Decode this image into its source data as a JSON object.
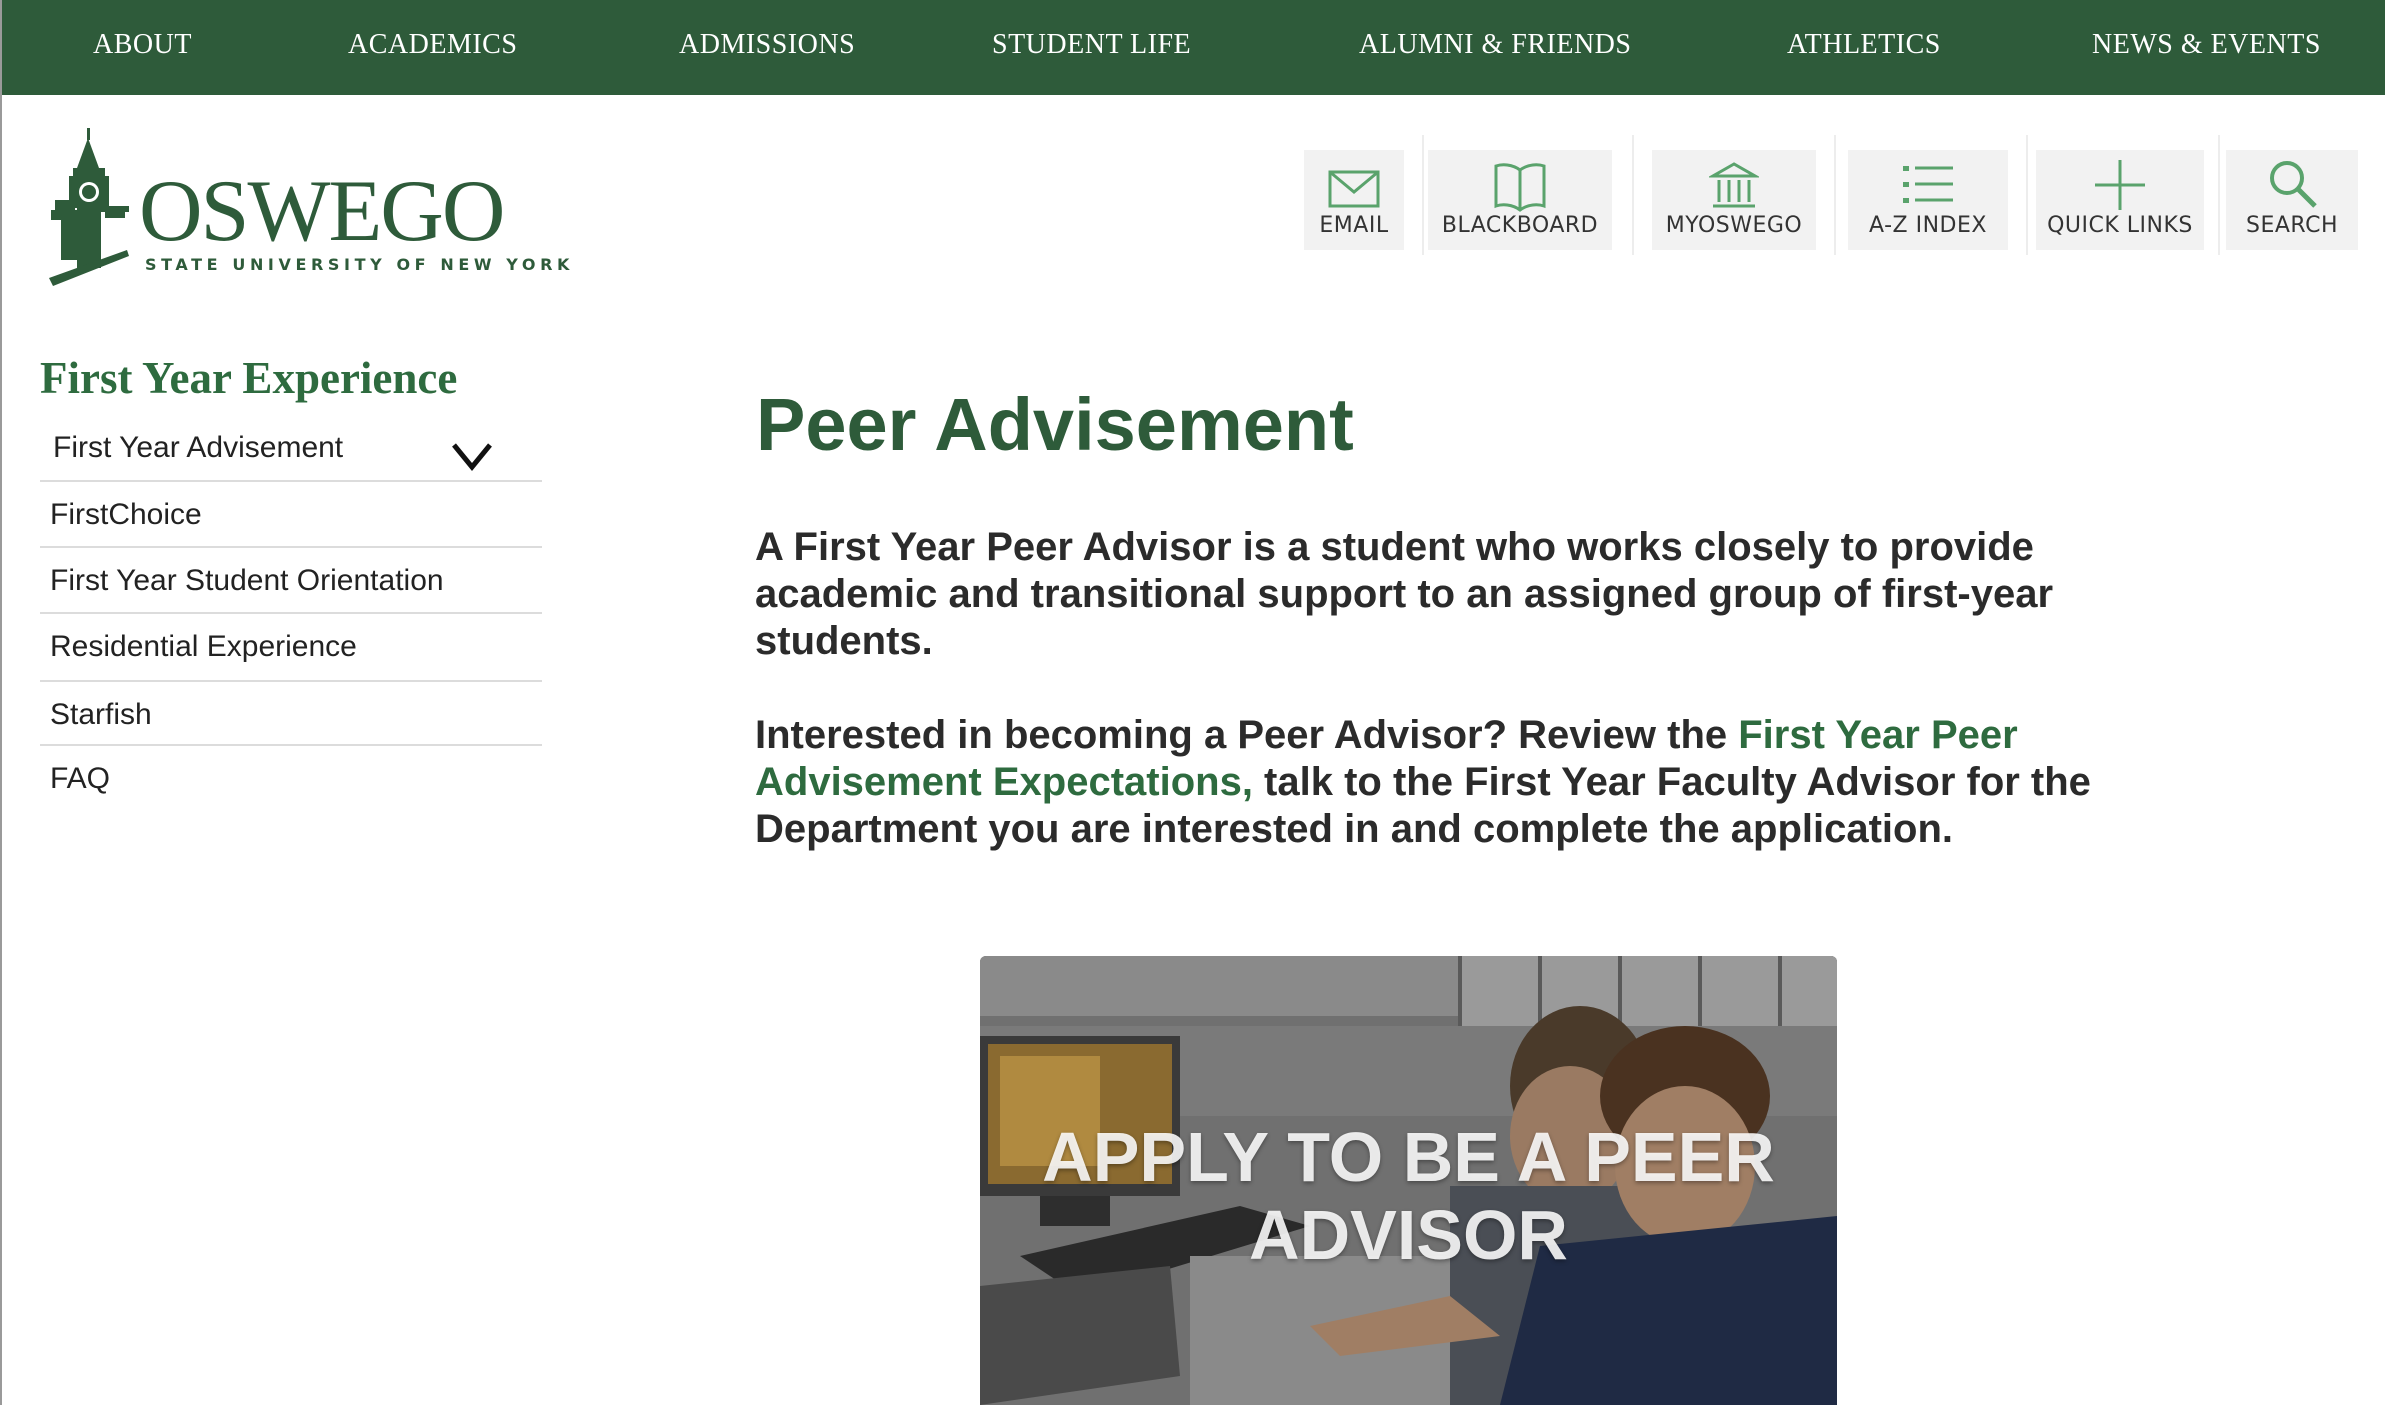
{
  "top_nav": {
    "items": [
      "ABOUT",
      "ACADEMICS",
      "ADMISSIONS",
      "STUDENT LIFE",
      "ALUMNI & FRIENDS",
      "ATHLETICS",
      "NEWS & EVENTS"
    ]
  },
  "logo": {
    "wordmark": "OSWEGO",
    "subline": "STATE UNIVERSITY OF NEW YORK"
  },
  "utility_links": [
    {
      "label": "EMAIL",
      "icon": "envelope-icon"
    },
    {
      "label": "BLACKBOARD",
      "icon": "book-icon"
    },
    {
      "label": "MYOSWEGO",
      "icon": "building-icon"
    },
    {
      "label": "A-Z INDEX",
      "icon": "list-icon"
    },
    {
      "label": "QUICK LINKS",
      "icon": "plus-icon"
    },
    {
      "label": "SEARCH",
      "icon": "search-icon"
    }
  ],
  "sidebar": {
    "title": "First Year Experience",
    "items": [
      {
        "label": "First Year Advisement",
        "expanded_icon": "chevron-down-icon"
      },
      {
        "label": "FirstChoice"
      },
      {
        "label": "First Year Student Orientation"
      },
      {
        "label": "Residential Experience"
      },
      {
        "label": "Starfish"
      },
      {
        "label": "FAQ"
      }
    ]
  },
  "main": {
    "title": "Peer Advisement",
    "paragraph1": "A First Year Peer Advisor is a student who works closely to provide academic and transitional support to an assigned group of first-year students.",
    "paragraph2_before": "Interested in becoming a Peer Advisor? Review the ",
    "paragraph2_link": "First Year Peer Advisement Expectations,",
    "paragraph2_after": " talk to the First Year Faculty Advisor for the Department you are interested in and complete the application.",
    "apply_banner": "APPLY TO BE A PEER ADVISOR"
  },
  "colors": {
    "brand_green": "#2e5b3a",
    "link_green": "#2e6b3f",
    "text": "#2b2b2b"
  }
}
